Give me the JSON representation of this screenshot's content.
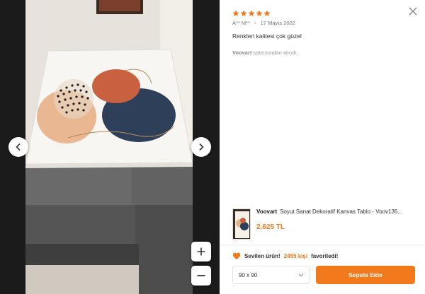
{
  "review": {
    "rating": 5,
    "author": "A** M**",
    "date": "17 Mayıs 2022",
    "text": "Renkleri kalitesi çok güzel",
    "seller_name": "Voovart",
    "seller_suffix": " satıcısından alındı."
  },
  "product": {
    "brand": "Voovart",
    "title": "Soyut Sanat Dekoratif Kanvas Tablo - Voov135...",
    "price": "2.625 TL"
  },
  "favorites": {
    "prefix": "Sevilen ürün!",
    "count": "2455 kişi",
    "suffix": "favoriledi!"
  },
  "size_select": {
    "value": "90 x 90"
  },
  "cart_button": {
    "label": "Sepete Ekle"
  },
  "colors": {
    "accent": "#f27a1a",
    "star": "#f27a1a",
    "viewer_bg": "#1b1b1b"
  },
  "icons": [
    "close-icon",
    "chevron-left-icon",
    "chevron-right-icon",
    "plus-icon",
    "minus-icon",
    "heart-icon",
    "star-icon",
    "chevron-down-icon"
  ]
}
